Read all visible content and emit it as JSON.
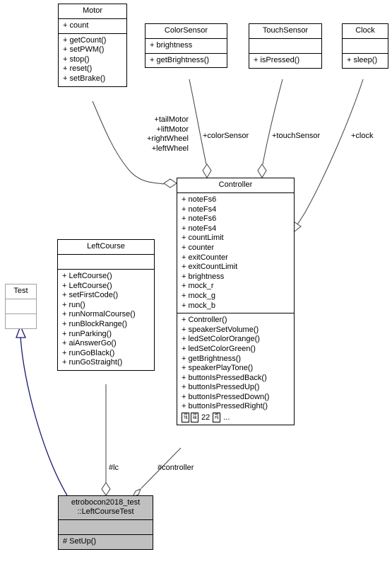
{
  "diagram": {
    "kind": "uml-collaboration-diagram",
    "background": "#ffffff",
    "inheritance_color": "#191970",
    "association_color": "#404040",
    "highlight_fill": "#c0c0c0"
  },
  "classes": {
    "motor": {
      "name": "Motor",
      "attributes": [
        "+ count"
      ],
      "operations": [
        "+ getCount()",
        "+ setPWM()",
        "+ stop()",
        "+ reset()",
        "+ setBrake()"
      ]
    },
    "color_sensor": {
      "name": "ColorSensor",
      "attributes": [
        "+ brightness"
      ],
      "operations": [
        "+ getBrightness()"
      ]
    },
    "touch_sensor": {
      "name": "TouchSensor",
      "attributes": [],
      "operations": [
        "+ isPressed()"
      ]
    },
    "clock": {
      "name": "Clock",
      "attributes": [],
      "operations": [
        "+ sleep()"
      ]
    },
    "controller": {
      "name": "Controller",
      "attributes": [
        "+ noteFs6",
        "+ noteFs4",
        "+ noteFs6",
        "+ noteFs4",
        "+ countLimit",
        "+ counter",
        "+ exitCounter",
        "+ exitCountLimit",
        "+ brightness",
        "+ mock_r",
        "+ mock_g",
        "+ mock_b"
      ],
      "operations": [
        "+ Controller()",
        "+ speakerSetVolume()",
        "+ ledSetColorOrange()",
        "+ ledSetColorGreen()",
        "+ getBrightness()",
        "+ speakerPlayTone()",
        "+ buttonIsPressedBack()",
        "+ buttonIsPressedUp()",
        "+ buttonIsPressedDown()",
        "+ buttonIsPressedRight()"
      ],
      "overflow_row": {
        "glyph_1_hex_top": "30",
        "glyph_1_hex_bottom": "7B",
        "glyph_2_hex_top": "30",
        "glyph_2_hex_bottom": "4B",
        "count": "22",
        "glyph_3_hex_top": "4E",
        "glyph_3_hex_bottom": "F6",
        "ellipsis": "..."
      }
    },
    "left_course": {
      "name": "LeftCourse",
      "attributes": [],
      "operations": [
        "+ LeftCourse()",
        "+ LeftCourse()",
        "+ setFirstCode()",
        "+ run()",
        "+ runNormalCourse()",
        "+ runBlockRange()",
        "+ runParking()",
        "+ aiAnswerGo()",
        "+ runGoBlack()",
        "+ runGoStraight()"
      ]
    },
    "test": {
      "name": "Test",
      "attributes": [],
      "operations": []
    },
    "left_course_test": {
      "name": "etrobocon2018_test\n::LeftCourseTest",
      "attributes": [],
      "operations": [
        "# SetUp()"
      ]
    }
  },
  "edges": {
    "motor_to_controller": "+tailMotor\n+liftMotor\n+rightWheel\n+leftWheel",
    "color_sensor_to_controller": "+colorSensor",
    "touch_sensor_to_controller": "+touchSensor",
    "clock_to_controller": "+clock",
    "left_course_to_test_class": "#lc",
    "controller_to_test_class": "#controller"
  }
}
